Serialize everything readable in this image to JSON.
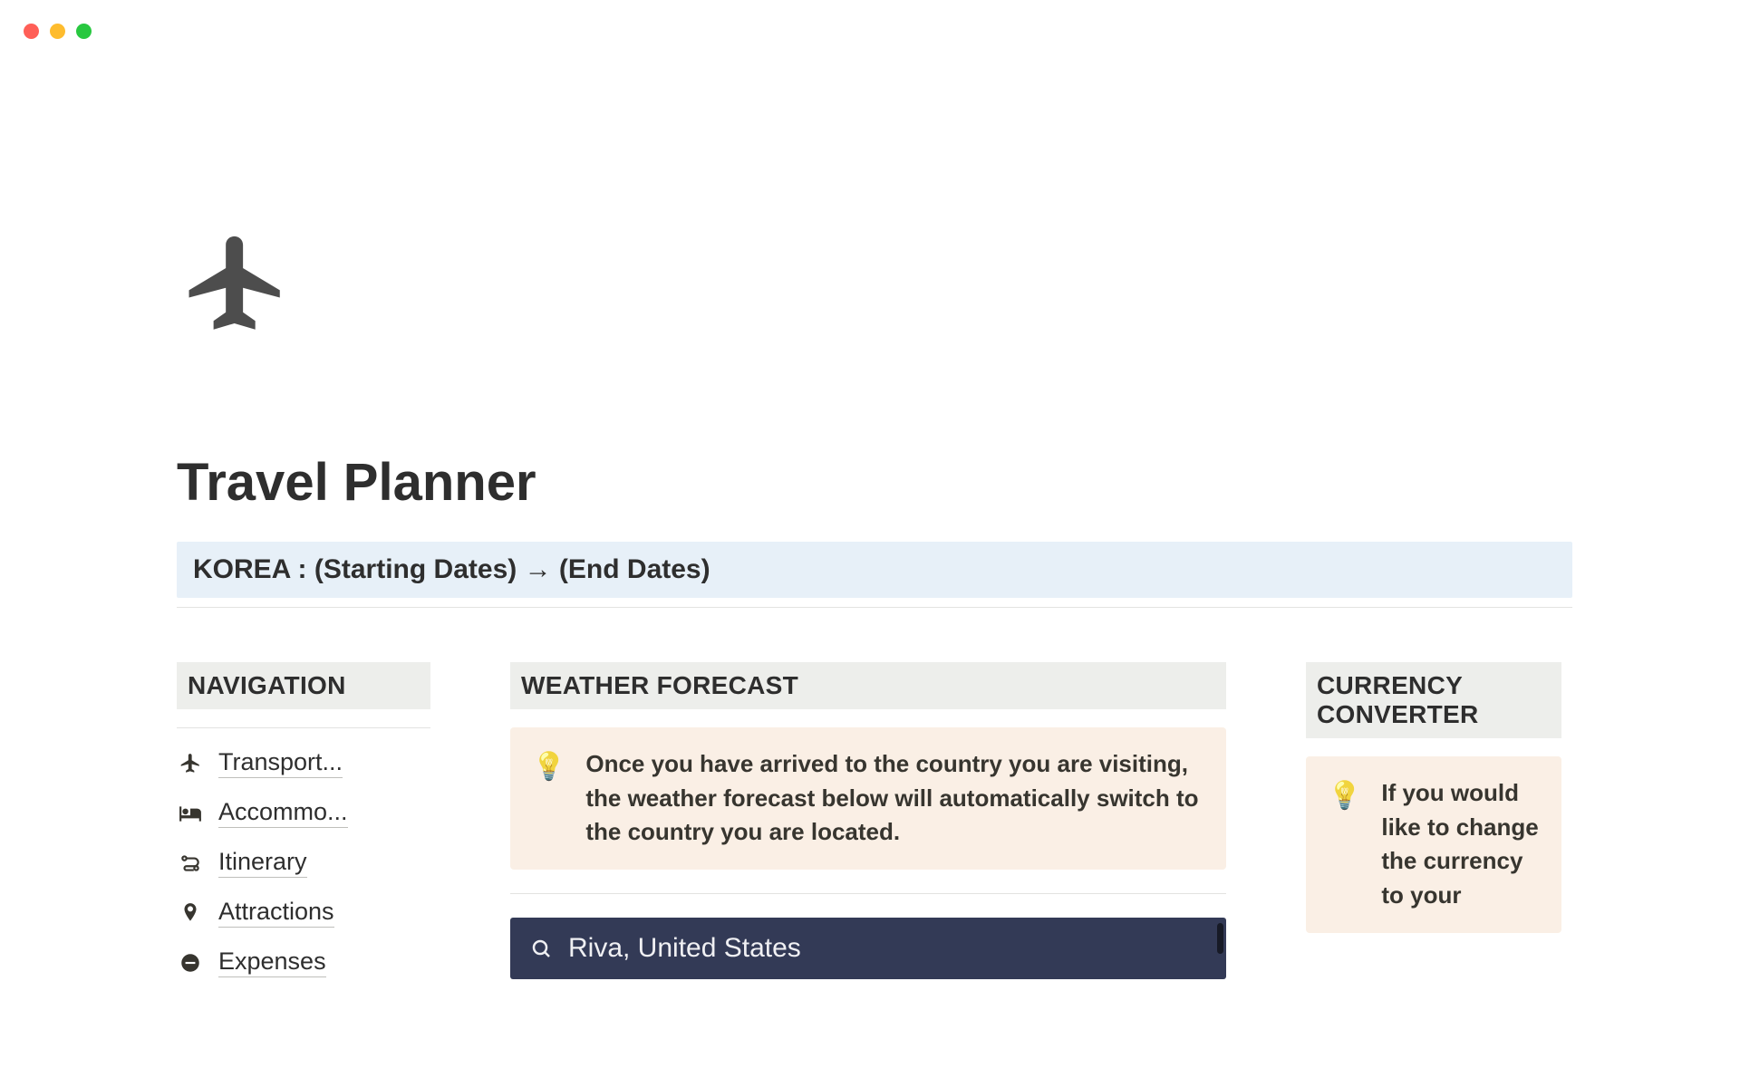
{
  "page": {
    "title": "Travel Planner",
    "date_banner": "KOREA  :  (Starting Dates)  → (End Dates)"
  },
  "nav": {
    "heading": "NAVIGATION",
    "items": {
      "transport": "Transport...",
      "accommodation": "Accommo...",
      "itinerary": "Itinerary",
      "attractions": "Attractions",
      "expenses": "Expenses"
    }
  },
  "weather": {
    "heading": "WEATHER FORECAST",
    "callout": "Once you have arrived to the country you are visiting, the weather forecast below will automatically switch to the country you are located.",
    "search_value": "Riva, United States"
  },
  "currency": {
    "heading": "CURRENCY CONVERTER",
    "callout": "If you would like to change the currency to your"
  }
}
